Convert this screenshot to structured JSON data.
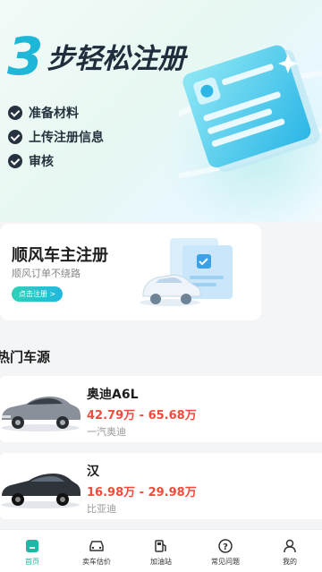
{
  "hero": {
    "number": "3",
    "title": "步轻松注册",
    "steps": [
      "准备材料",
      "上传注册信息",
      "审核"
    ]
  },
  "register_card": {
    "title": "顺风车主注册",
    "subtitle": "顺风订单不绕路",
    "button": "点击注册 >"
  },
  "hot_section": {
    "title": "热门车源"
  },
  "cars": [
    {
      "name": "奥迪A6L",
      "price": "42.79万 - 65.68万",
      "brand": "一汽奥迪"
    },
    {
      "name": "汉",
      "price": "16.98万 - 29.98万",
      "brand": "比亚迪"
    }
  ],
  "nav": [
    {
      "label": "首页",
      "icon": "home-icon",
      "active": true
    },
    {
      "label": "卖车估价",
      "icon": "car-valuation-icon"
    },
    {
      "label": "加油站",
      "icon": "gas-station-icon"
    },
    {
      "label": "常见问题",
      "icon": "question-icon"
    },
    {
      "label": "我的",
      "icon": "user-icon"
    }
  ],
  "colors": {
    "accent": "#1fb7a5",
    "price": "#f24b3b",
    "title_blue": "#1fb7d7"
  }
}
